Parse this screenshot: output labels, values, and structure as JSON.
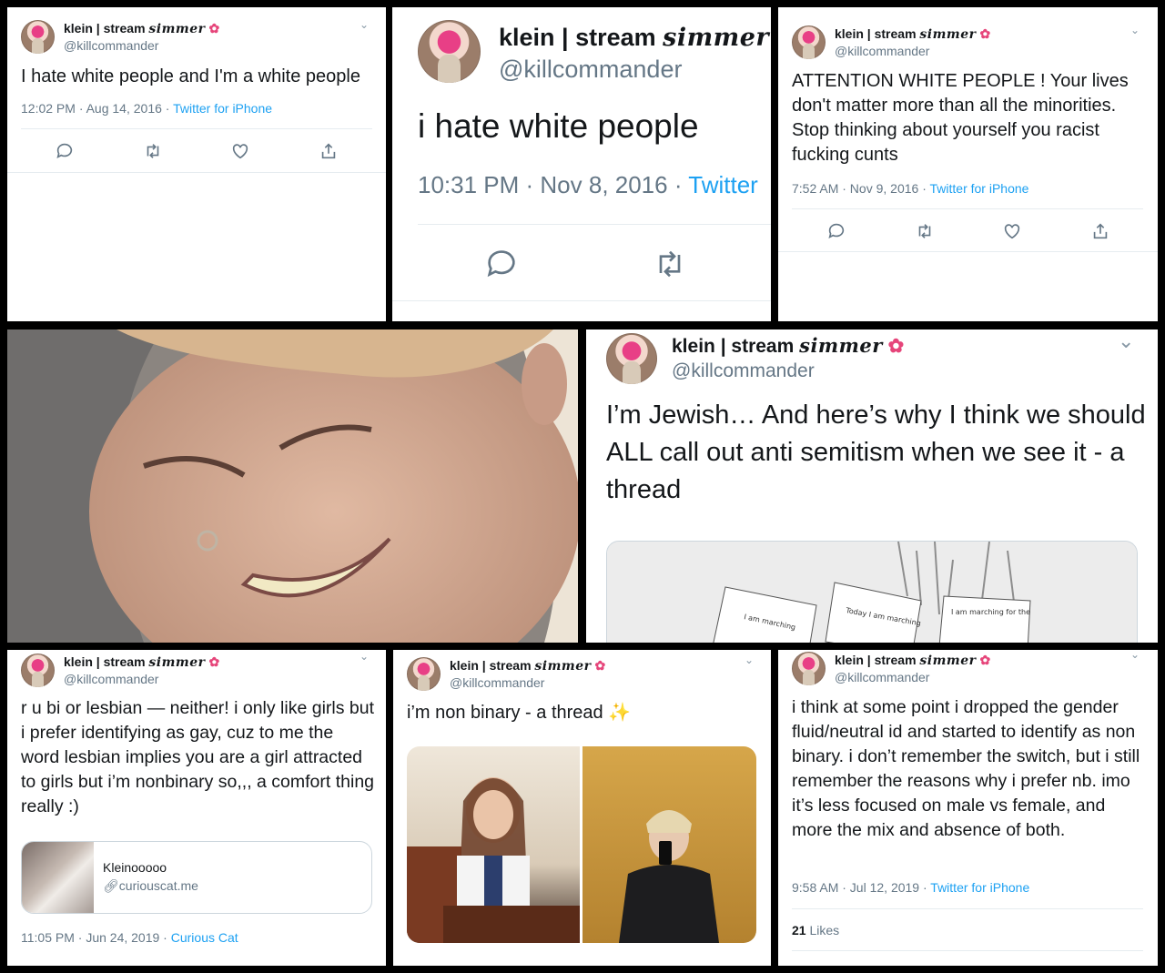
{
  "account": {
    "display_name": "klein | stream",
    "display_name_suffix": "simmer",
    "handle": "@killcommander",
    "flower_icon": "hibiscus-icon"
  },
  "tweets": {
    "t1": {
      "text": "I hate white people and I'm a white people",
      "time": "12:02 PM · Aug 14, 2016",
      "source": "Twitter for iPhone"
    },
    "t2": {
      "text": "i hate white people",
      "time": "10:31 PM · Nov 8, 2016 ·",
      "source": "Twitter"
    },
    "t3": {
      "text": "ATTENTION WHITE PEOPLE ! Your lives don't matter more than all the minorities. Stop thinking about yourself you racist fucking cunts",
      "time": "7:52 AM · Nov 9, 2016",
      "source": "Twitter for iPhone"
    },
    "t4": {
      "text": "I’m Jewish… And here’s why I think we should ALL call out anti semitism when we see it - a thread"
    },
    "t5": {
      "text": "r u bi or lesbian — neither! i only like girls but i prefer identifying as gay, cuz to me the word lesbian implies you are a girl attracted to girls but i’m nonbinary so,,, a comfort thing really :)",
      "card_title": "Kleinooooo",
      "card_domain": "curiouscat.me",
      "time": "11:05 PM · Jun 24, 2019",
      "source": "Curious Cat"
    },
    "t6": {
      "text": "i’m non binary - a thread",
      "emoji": "✨"
    },
    "t7": {
      "text": "i think at some point i dropped the gender fluid/neutral id and started to identify as non binary. i don’t remember the switch, but i still remember the reasons why i prefer nb. imo it’s less focused on male vs female, and more the mix and absence of both.",
      "time": "9:58 AM · Jul 12, 2019",
      "source": "Twitter for iPhone",
      "likes_count": "21",
      "likes_label": "Likes"
    }
  },
  "colors": {
    "link": "#1da1f2",
    "muted": "#657786",
    "text": "#14171a",
    "divider": "#e6ecf0"
  }
}
